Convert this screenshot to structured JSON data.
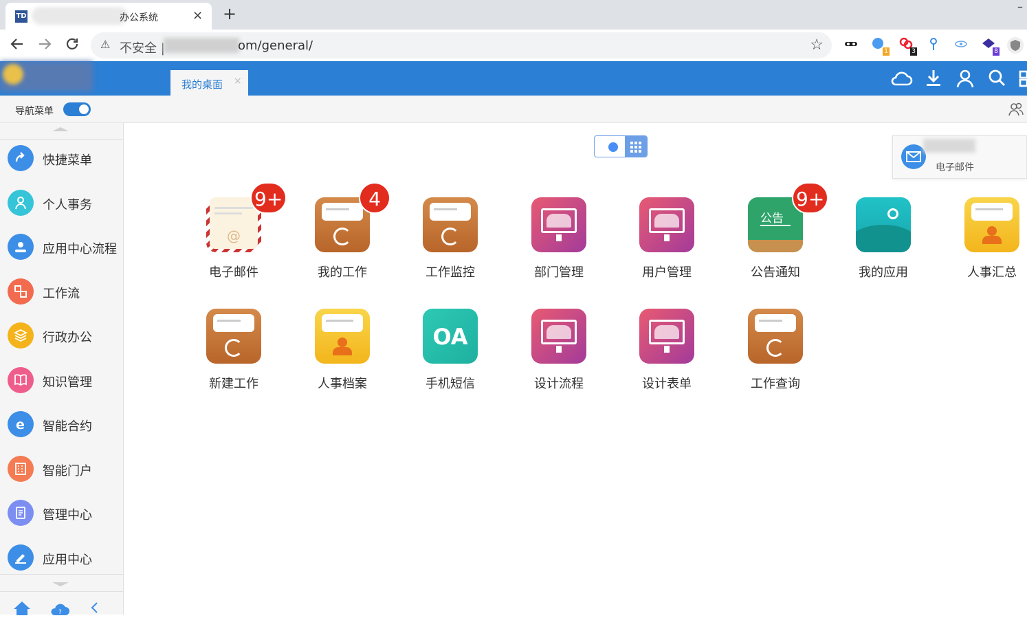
{
  "browser": {
    "tab_title": "办公系统",
    "tab_close": "×",
    "new_tab": "+",
    "insecure_label": "不安全 |",
    "url": "om/general/",
    "star": "☆",
    "extensions": [
      {
        "name": "incognito-ext-icon",
        "badge": ""
      },
      {
        "name": "blue-ext-icon",
        "badge": "1"
      },
      {
        "name": "red-ext-icon",
        "badge": "3"
      },
      {
        "name": "pin-ext-icon",
        "badge": ""
      },
      {
        "name": "eye-ext-icon",
        "badge": ""
      },
      {
        "name": "purple-ext-icon",
        "badge": "8"
      },
      {
        "name": "shield-ext-icon",
        "badge": ""
      }
    ]
  },
  "header": {
    "active_tab": "我的桌面",
    "active_tab_close": "×",
    "icons": [
      "cloud-icon",
      "download-icon",
      "user-icon",
      "search-icon",
      "grid-icon"
    ]
  },
  "subbar": {
    "nav_menu_label": "导航菜单"
  },
  "sidebar": {
    "items": [
      {
        "label": "快捷菜单",
        "color": "#3c8ee6"
      },
      {
        "label": "个人事务",
        "color": "#35c4d8"
      },
      {
        "label": "应用中心流程",
        "color": "#3c8ee6"
      },
      {
        "label": "工作流",
        "color": "#f26b4f"
      },
      {
        "label": "行政办公",
        "color": "#f5b31b"
      },
      {
        "label": "知识管理",
        "color": "#ee5d8c"
      },
      {
        "label": "智能合约",
        "color": "#3c8ee6"
      },
      {
        "label": "智能门户",
        "color": "#f47b52"
      },
      {
        "label": "管理中心",
        "color": "#7d8ef2"
      },
      {
        "label": "应用中心",
        "color": "#3c8ee6"
      }
    ]
  },
  "apps": [
    {
      "label": "电子邮件",
      "badge": "9+",
      "style": "mail"
    },
    {
      "label": "我的工作",
      "badge": "4",
      "style": "folder"
    },
    {
      "label": "工作监控",
      "badge": "",
      "style": "folder"
    },
    {
      "label": "部门管理",
      "badge": "",
      "style": "meeting"
    },
    {
      "label": "用户管理",
      "badge": "",
      "style": "meeting"
    },
    {
      "label": "公告通知",
      "badge": "9+",
      "style": "board"
    },
    {
      "label": "我的应用",
      "badge": "",
      "style": "map"
    },
    {
      "label": "人事汇总",
      "badge": "",
      "style": "person"
    },
    {
      "label": "新建工作",
      "badge": "",
      "style": "folder"
    },
    {
      "label": "人事档案",
      "badge": "",
      "style": "person"
    },
    {
      "label": "手机短信",
      "badge": "",
      "style": "oa"
    },
    {
      "label": "设计流程",
      "badge": "",
      "style": "meeting"
    },
    {
      "label": "设计表单",
      "badge": "",
      "style": "meeting"
    },
    {
      "label": "工作查询",
      "badge": "",
      "style": "folder"
    }
  ],
  "board_text": "公告",
  "oa_text": "OA",
  "notification": {
    "label": "电子邮件"
  }
}
